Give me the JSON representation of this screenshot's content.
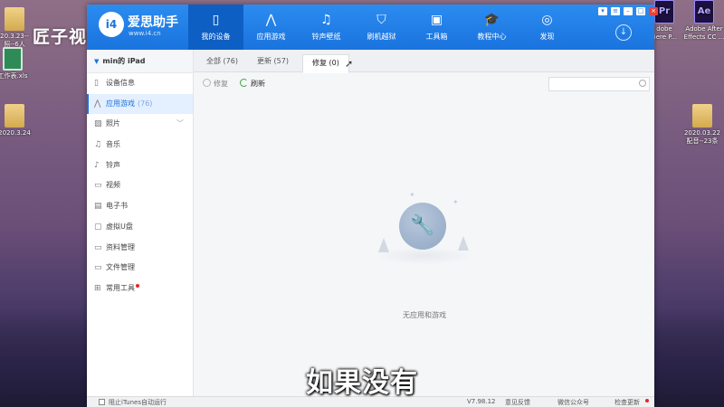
{
  "desktop": {
    "watermark": "匠子视频",
    "left_icons": [
      {
        "label": "20.3.23--\n照--6人",
        "kind": "folder"
      },
      {
        "label": "工作表.xls",
        "kind": "xls"
      },
      {
        "label": "2020.3.24",
        "kind": "folder"
      }
    ],
    "right_icons": [
      {
        "label": "dobe\nriere P...",
        "kind": "ae"
      },
      {
        "label": "Adobe After\nEffects CC ...",
        "kind": "ae"
      },
      {
        "label": "2020.03.22\n配音--23条",
        "kind": "folder"
      }
    ],
    "subtitle": "如果没有"
  },
  "app": {
    "logo_text": "i4",
    "brand": "爱思助手",
    "brand_url": "www.i4.cn",
    "nav": [
      {
        "label": "我的设备",
        "icon": "phone-icon",
        "glyph": "▯",
        "active": true
      },
      {
        "label": "应用游戏",
        "icon": "appstore-icon",
        "glyph": "⋀",
        "active": false
      },
      {
        "label": "铃声壁纸",
        "icon": "music-wallpaper-icon",
        "glyph": "♫",
        "active": false
      },
      {
        "label": "刷机越狱",
        "icon": "shield-icon",
        "glyph": "⛉",
        "active": false
      },
      {
        "label": "工具箱",
        "icon": "toolbox-icon",
        "glyph": "▣",
        "active": false
      },
      {
        "label": "教程中心",
        "icon": "graduation-cap-icon",
        "glyph": "🎓",
        "active": false
      },
      {
        "label": "发现",
        "icon": "compass-icon",
        "glyph": "◎",
        "active": false
      }
    ],
    "device_name": "min的 iPad",
    "sidebar": [
      {
        "label": "设备信息",
        "icon": "device-info-icon",
        "glyph": "▯"
      },
      {
        "label": "应用游戏",
        "count": "(76)",
        "icon": "appstore-icon",
        "glyph": "⋀",
        "active": true
      },
      {
        "label": "照片",
        "icon": "photo-icon",
        "glyph": "▨",
        "chevron": "﹀"
      },
      {
        "label": "音乐",
        "icon": "music-icon",
        "glyph": "♫"
      },
      {
        "label": "铃声",
        "icon": "bell-icon",
        "glyph": "♪"
      },
      {
        "label": "视频",
        "icon": "video-icon",
        "glyph": "▭"
      },
      {
        "label": "电子书",
        "icon": "ebook-icon",
        "glyph": "▤"
      },
      {
        "label": "虚拟U盘",
        "icon": "usb-drive-icon",
        "glyph": "▢"
      },
      {
        "label": "资料管理",
        "icon": "folder-icon",
        "glyph": "▭"
      },
      {
        "label": "文件管理",
        "icon": "file-icon",
        "glyph": "▭"
      },
      {
        "label": "常用工具",
        "icon": "tools-grid-icon",
        "glyph": "⊞",
        "reddot": true
      }
    ],
    "tabs": [
      {
        "label": "全部 (76)"
      },
      {
        "label": "更新 (57)"
      },
      {
        "label": "修复 (0)",
        "active": true
      }
    ],
    "toolbar": {
      "repair": "修复",
      "refresh": "刷新"
    },
    "search_placeholder": "",
    "empty_text": "无应用和游戏",
    "status": {
      "itunes_checkbox": "阻止iTunes自动运行",
      "version": "V7.98.12",
      "feedback": "意见反馈",
      "wechat": "微信公众号",
      "update": "检查更新"
    }
  }
}
